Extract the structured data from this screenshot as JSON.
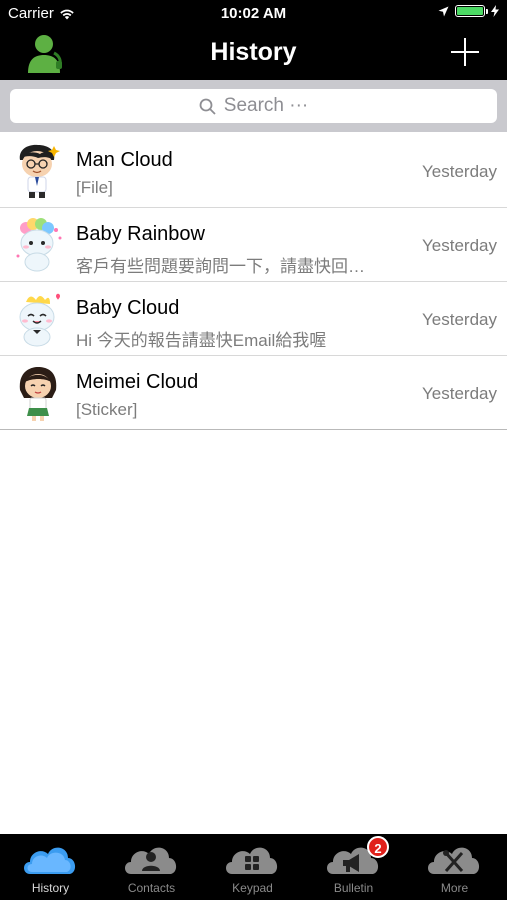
{
  "status": {
    "carrier": "Carrier",
    "time": "10:02 AM"
  },
  "nav": {
    "title": "History"
  },
  "search": {
    "placeholder": "Search ···"
  },
  "conversations": [
    {
      "name": "Man Cloud",
      "preview": "[File]",
      "time": "Yesterday",
      "avatar": "man-cloud-avatar"
    },
    {
      "name": "Baby Rainbow",
      "preview": "客戶有些問題要詢問一下，請盡快回…",
      "time": "Yesterday",
      "avatar": "baby-rainbow-avatar"
    },
    {
      "name": "Baby Cloud",
      "preview": "Hi 今天的報告請盡快Email給我喔",
      "time": "Yesterday",
      "avatar": "baby-cloud-avatar"
    },
    {
      "name": "Meimei Cloud",
      "preview": "[Sticker]",
      "time": "Yesterday",
      "avatar": "meimei-cloud-avatar"
    }
  ],
  "tabs": [
    {
      "label": "History",
      "icon": "history-cloud-icon",
      "active": true
    },
    {
      "label": "Contacts",
      "icon": "contacts-icon"
    },
    {
      "label": "Keypad",
      "icon": "keypad-icon"
    },
    {
      "label": "Bulletin",
      "icon": "bulletin-icon",
      "badge": "2"
    },
    {
      "label": "More",
      "icon": "more-tools-icon"
    }
  ],
  "colors": {
    "bar_bg": "#000000",
    "search_bg": "#c9c9ce",
    "badge": "#e0201b",
    "accent_blue": "#2b8ee6"
  }
}
